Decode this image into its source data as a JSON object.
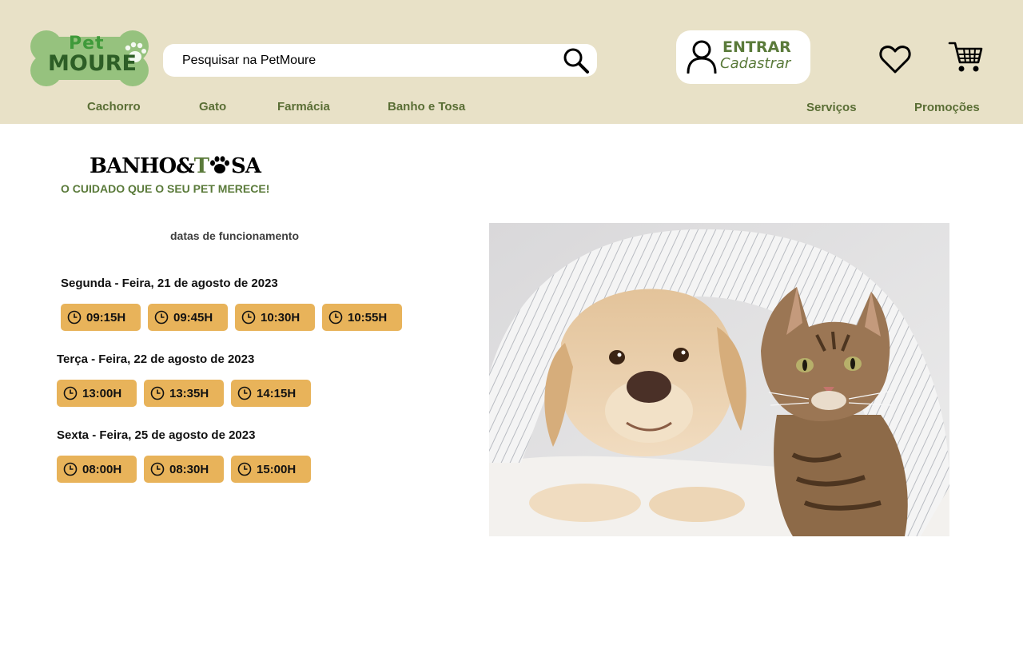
{
  "header": {
    "logo": {
      "word_top": "Pet",
      "word_bottom": "MOURE"
    },
    "search": {
      "placeholder": "Pesquisar na PetMoure"
    },
    "login": {
      "primary": "ENTRAR",
      "secondary": "Cadastrar"
    },
    "icons": [
      "search-icon",
      "user-icon",
      "heart-icon",
      "cart-icon"
    ],
    "nav_left": [
      "Cachorro",
      "Gato",
      "Farmácia",
      "Banho e Tosa"
    ],
    "nav_right": [
      "Serviços",
      "Promoções"
    ]
  },
  "main": {
    "title_part1": "BANHO&",
    "title_part2": "T",
    "title_part3": "SA",
    "tagline": "O CUIDADO QUE O SEU PET MERECE!",
    "dates_heading": "datas de funcionamento",
    "days": [
      {
        "label": "Segunda - Feira, 21 de agosto de 2023",
        "slots": [
          "09:15H",
          "09:45H",
          "10:30H",
          "10:55H"
        ]
      },
      {
        "label": "Terça - Feira, 22 de agosto de 2023",
        "slots": [
          "13:00H",
          "13:35H",
          "14:15H"
        ]
      },
      {
        "label": "Sexta - Feira, 25 de agosto de 2023",
        "slots": [
          "08:00H",
          "08:30H",
          "15:00H"
        ]
      }
    ]
  },
  "colors": {
    "header_bg": "#e8e1c7",
    "accent_green": "#5a7a3a",
    "slot_bg": "#e8b35a"
  }
}
